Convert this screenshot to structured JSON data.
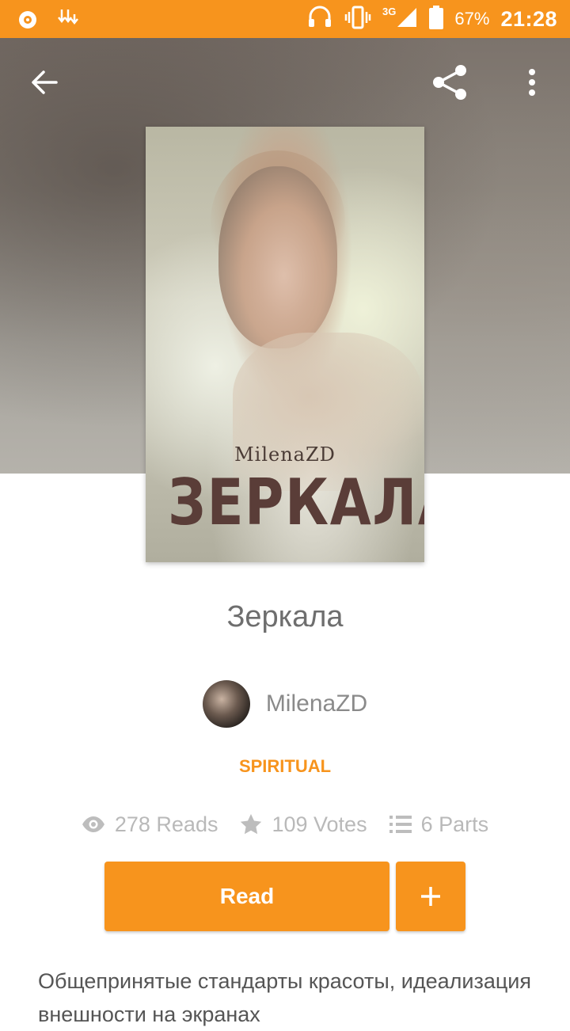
{
  "status_bar": {
    "network": "3G",
    "battery_percent": "67%",
    "time": "21:28",
    "accent_color": "#f7941d"
  },
  "app_bar": {
    "back_icon": "arrow-left-icon",
    "share_icon": "share-icon",
    "menu_icon": "more-vertical-icon"
  },
  "cover": {
    "author": "MilenaZD",
    "title": "ЗЕРКАЛА"
  },
  "story": {
    "title": "Зеркала",
    "author": "MilenaZD",
    "category": "SPIRITUAL",
    "reads": "278 Reads",
    "votes": "109 Votes",
    "parts": "6 Parts",
    "read_label": "Read",
    "add_label": "+",
    "description": "Общепринятые стандарты красоты, идеализация внешности на экранах"
  }
}
